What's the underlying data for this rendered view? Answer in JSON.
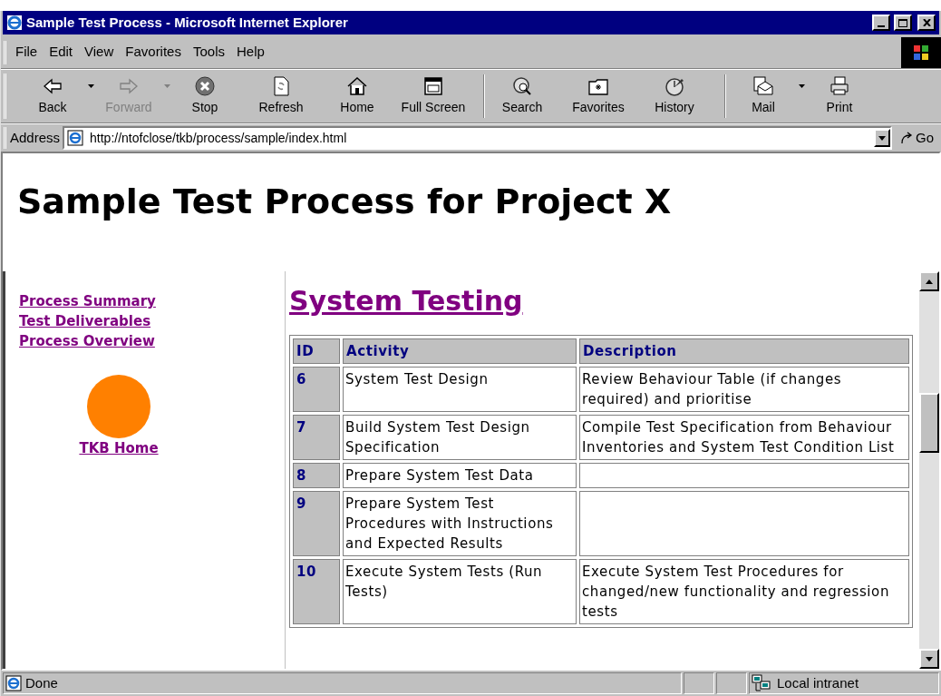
{
  "window": {
    "title": "Sample Test Process - Microsoft Internet Explorer"
  },
  "menu": [
    "File",
    "Edit",
    "View",
    "Favorites",
    "Tools",
    "Help"
  ],
  "toolbar": [
    {
      "label": "Back",
      "kind": "back",
      "disabled": false,
      "dropdown": true
    },
    {
      "label": "Forward",
      "kind": "forward",
      "disabled": true,
      "dropdown": true
    },
    {
      "label": "Stop",
      "kind": "stop",
      "disabled": false,
      "dropdown": false
    },
    {
      "label": "Refresh",
      "kind": "refresh",
      "disabled": false,
      "dropdown": false
    },
    {
      "label": "Home",
      "kind": "home",
      "disabled": false,
      "dropdown": false
    },
    {
      "label": "Full Screen",
      "kind": "fullscreen",
      "disabled": false,
      "dropdown": false
    },
    {
      "label": "Search",
      "kind": "search",
      "disabled": false,
      "dropdown": false
    },
    {
      "label": "Favorites",
      "kind": "favorites",
      "disabled": false,
      "dropdown": false
    },
    {
      "label": "History",
      "kind": "history",
      "disabled": false,
      "dropdown": false
    },
    {
      "label": "Mail",
      "kind": "mail",
      "disabled": false,
      "dropdown": true
    },
    {
      "label": "Print",
      "kind": "print",
      "disabled": false,
      "dropdown": false
    }
  ],
  "address_bar": {
    "label": "Address",
    "url": "http://ntofclose/tkb/process/sample/index.html",
    "go": "Go"
  },
  "page": {
    "heading": "Sample Test Process for Project X",
    "nav_links": [
      "Process Summary",
      "Test Deliverables",
      "Process Overview"
    ],
    "home_link": "TKB Home",
    "section_heading": "System Testing",
    "table": {
      "columns": [
        "ID",
        "Activity",
        "Description"
      ],
      "rows": [
        {
          "id": "6",
          "activity": "System Test Design",
          "description": "Review Behaviour Table (if changes required) and prioritise"
        },
        {
          "id": "7",
          "activity": "Build System Test Design Specification",
          "description": "Compile Test Specification from Behaviour Inventories and System Test Condition List"
        },
        {
          "id": "8",
          "activity": "Prepare System Test Data"
        },
        {
          "id": "9",
          "activity": "Prepare System Test Procedures with Instructions and Expected Results"
        },
        {
          "id": "10",
          "activity": "Execute System Tests (Run Tests)",
          "description": "Execute System Test Procedures for changed/new functionality and regression tests"
        }
      ]
    }
  },
  "status_bar": {
    "text": "Done",
    "zone": "Local intranet"
  }
}
